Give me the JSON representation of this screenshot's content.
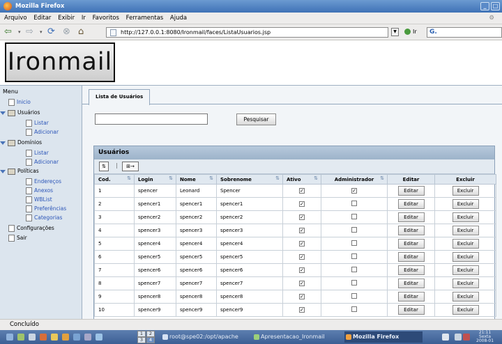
{
  "window": {
    "title": "Mozilla Firefox",
    "min_label": "_",
    "max_label": "□"
  },
  "menu": [
    "Arquivo",
    "Editar",
    "Exibir",
    "Ir",
    "Favoritos",
    "Ferramentas",
    "Ajuda"
  ],
  "nav": {
    "url": "http://127.0.0.1:8080/Ironmail/faces/ListaUsuarios.jsp",
    "go_label": "Ir",
    "search_value": "G."
  },
  "logo": "Ironmail",
  "sidebar": {
    "header": "Menu",
    "items": [
      {
        "label": "Inicio",
        "kind": "file",
        "link": true
      },
      {
        "label": "Usuários",
        "kind": "folder",
        "link": false
      },
      {
        "label": "Listar",
        "kind": "file",
        "link": true
      },
      {
        "label": "Adicionar",
        "kind": "file",
        "link": true
      },
      {
        "label": "Domínios",
        "kind": "folder",
        "link": false
      },
      {
        "label": "Listar",
        "kind": "file",
        "link": true
      },
      {
        "label": "Adicionar",
        "kind": "file",
        "link": true
      },
      {
        "label": "Políticas",
        "kind": "folder",
        "link": false
      },
      {
        "label": "Endereços",
        "kind": "file",
        "link": true
      },
      {
        "label": "Anexos",
        "kind": "file",
        "link": true
      },
      {
        "label": "WBList",
        "kind": "file",
        "link": true
      },
      {
        "label": "Preferências",
        "kind": "file",
        "link": true
      },
      {
        "label": "Categorias",
        "kind": "file",
        "link": true
      },
      {
        "label": "Configurações",
        "kind": "file",
        "link": false
      },
      {
        "label": "Sair",
        "kind": "file",
        "link": false
      }
    ]
  },
  "main": {
    "tab": "Lista de Usuários",
    "search_button": "Pesquisar",
    "panel_title": "Usuários",
    "columns": [
      "Cod.",
      "Login",
      "Nome",
      "Sobrenome",
      "Ativo",
      "Administrador",
      "Editar",
      "Excluir"
    ],
    "edit_label": "Editar",
    "delete_label": "Excluir",
    "rows": [
      {
        "cod": "1",
        "login": "spencer",
        "nome": "Leonard",
        "sobrenome": "Spencer",
        "ativo": true,
        "admin": true
      },
      {
        "cod": "2",
        "login": "spencer1",
        "nome": "spencer1",
        "sobrenome": "spencer1",
        "ativo": true,
        "admin": false
      },
      {
        "cod": "3",
        "login": "spencer2",
        "nome": "spencer2",
        "sobrenome": "spencer2",
        "ativo": true,
        "admin": false
      },
      {
        "cod": "4",
        "login": "spencer3",
        "nome": "spencer3",
        "sobrenome": "spencer3",
        "ativo": true,
        "admin": false
      },
      {
        "cod": "5",
        "login": "spencer4",
        "nome": "spencer4",
        "sobrenome": "spencer4",
        "ativo": true,
        "admin": false
      },
      {
        "cod": "6",
        "login": "spencer5",
        "nome": "spencer5",
        "sobrenome": "spencer5",
        "ativo": true,
        "admin": false
      },
      {
        "cod": "7",
        "login": "spencer6",
        "nome": "spencer6",
        "sobrenome": "spencer6",
        "ativo": true,
        "admin": false
      },
      {
        "cod": "8",
        "login": "spencer7",
        "nome": "spencer7",
        "sobrenome": "spencer7",
        "ativo": true,
        "admin": false
      },
      {
        "cod": "9",
        "login": "spencer8",
        "nome": "spencer8",
        "sobrenome": "spencer8",
        "ativo": true,
        "admin": false
      },
      {
        "cod": "10",
        "login": "spencer9",
        "nome": "spencer9",
        "sobrenome": "spencer9",
        "ativo": true,
        "admin": false
      }
    ]
  },
  "status": "Concluído",
  "taskbar": {
    "pager": [
      "1",
      "2",
      "3",
      "4"
    ],
    "tasks": [
      {
        "label": "root@spe02:/opt/apache",
        "active": false
      },
      {
        "label": "Apresentacao_Ironmail",
        "active": false
      },
      {
        "label": "Mozilla Firefox",
        "active": true
      }
    ],
    "clock": [
      "21:11",
      "Sexta",
      "2008-01"
    ]
  }
}
